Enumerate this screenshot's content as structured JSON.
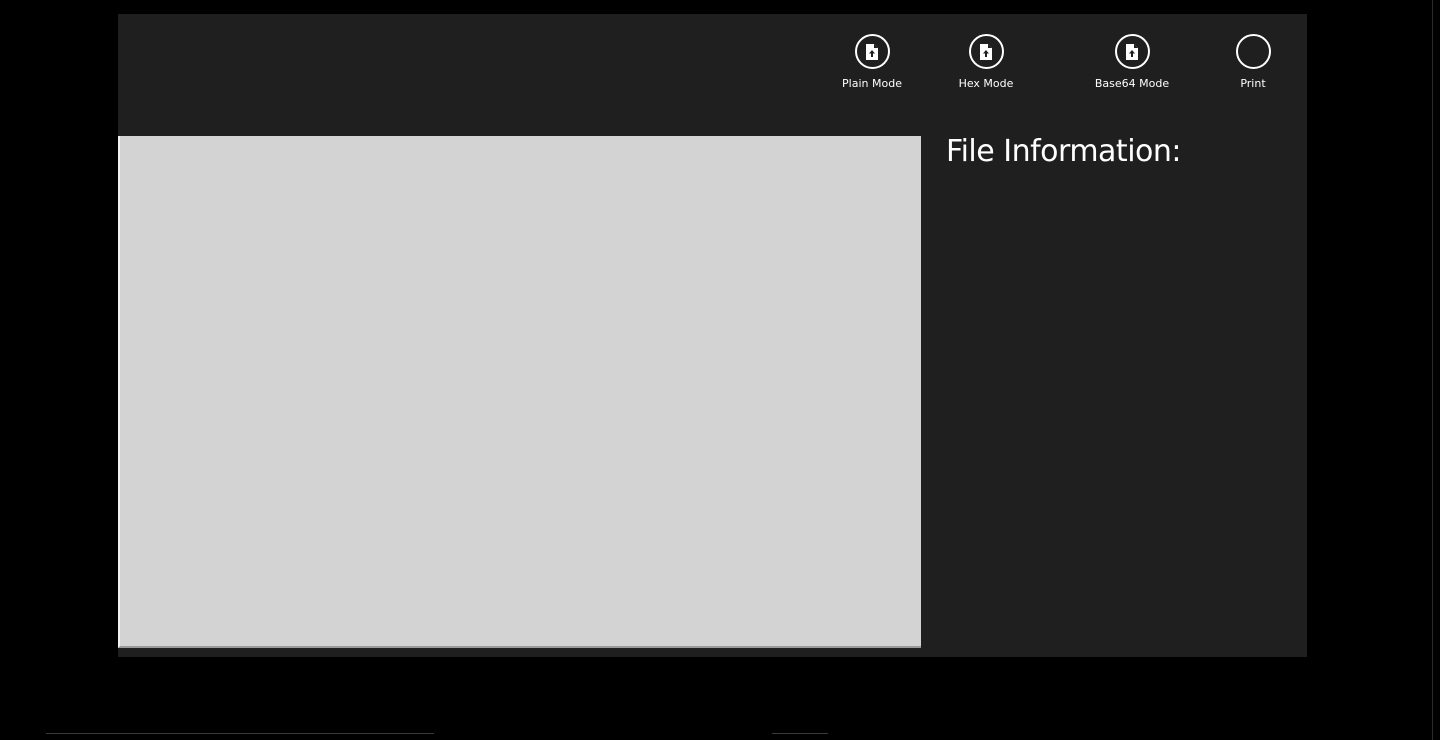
{
  "command_bar": {
    "buttons": [
      {
        "label": "Plain Mode",
        "icon": "file-upload-icon"
      },
      {
        "label": "Hex Mode",
        "icon": "file-upload-icon"
      },
      {
        "label": "Base64 Mode",
        "icon": "file-upload-icon"
      },
      {
        "label": "Print",
        "icon": "blank-circle-icon"
      }
    ]
  },
  "info_panel": {
    "title": "File Information:"
  },
  "colors": {
    "app_background": "#1f1f1f",
    "screen_background": "#000000",
    "viewer_background": "#d3d3d3",
    "text": "#ffffff"
  }
}
